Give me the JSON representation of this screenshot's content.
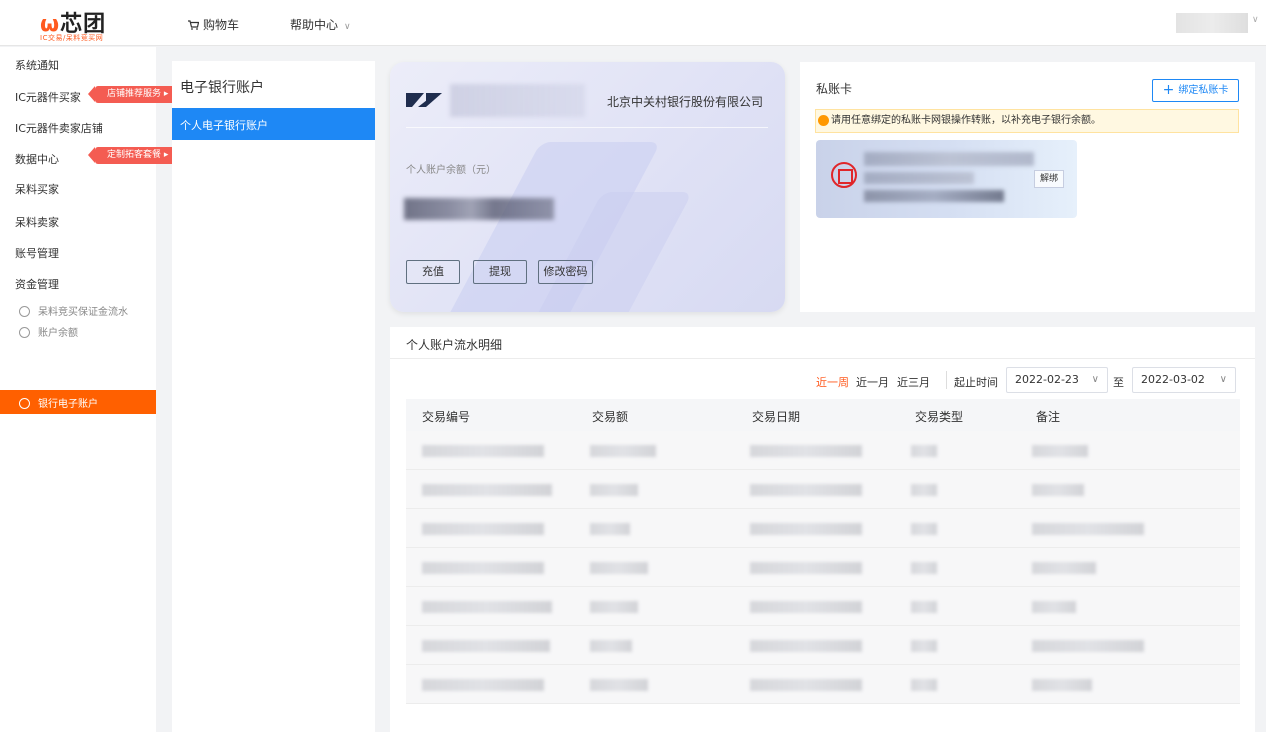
{
  "header": {
    "logo_text": "芯团",
    "logo_sub": "IC交易/呆料竞买网",
    "nav": [
      {
        "label": "购物车",
        "icon": "cart-icon"
      },
      {
        "label": "帮助中心",
        "icon": "chevron-down-icon"
      }
    ]
  },
  "sidebar": {
    "items": [
      {
        "label": "系统通知"
      },
      {
        "label": "IC元器件买家",
        "tag": "店铺推荐服务 ▸"
      },
      {
        "label": "IC元器件卖家店铺"
      },
      {
        "label": "数据中心",
        "tag": "定制拓客套餐 ▸"
      },
      {
        "label": "呆料买家"
      },
      {
        "label": "呆料卖家"
      },
      {
        "label": "账号管理"
      },
      {
        "label": "资金管理"
      }
    ],
    "sub_items": [
      {
        "label": "呆料竞买保证金流水"
      },
      {
        "label": "账户余额"
      },
      {
        "label": "银行电子账户",
        "active": true
      }
    ]
  },
  "ebank_panel": {
    "title": "电子银行账户",
    "selected": "个人电子银行账户"
  },
  "card": {
    "bank_name": "北京中关村银行股份有限公司",
    "balance_label": "个人账户余额（元）",
    "buttons": [
      "充值",
      "提现",
      "修改密码"
    ]
  },
  "private_card": {
    "title": "私账卡",
    "bind_label": "绑定私账卡",
    "notice": "请用任意绑定的私账卡网银操作转账，以补充电子银行余额。",
    "unbind_label": "解绑"
  },
  "flow": {
    "title": "个人账户流水明细",
    "ranges": [
      {
        "label": "近一周",
        "active": true
      },
      {
        "label": "近一月",
        "active": false
      },
      {
        "label": "近三月",
        "active": false
      }
    ],
    "date_label": "起止时间",
    "start_date": "2022-02-23",
    "to_label": "至",
    "end_date": "2022-03-02",
    "columns": [
      "交易编号",
      "交易额",
      "交易日期",
      "交易类型",
      "备注"
    ],
    "row_count": 7
  },
  "colors": {
    "accent": "#ff6000",
    "primary": "#1e88f5",
    "tag": "#f45c52"
  }
}
